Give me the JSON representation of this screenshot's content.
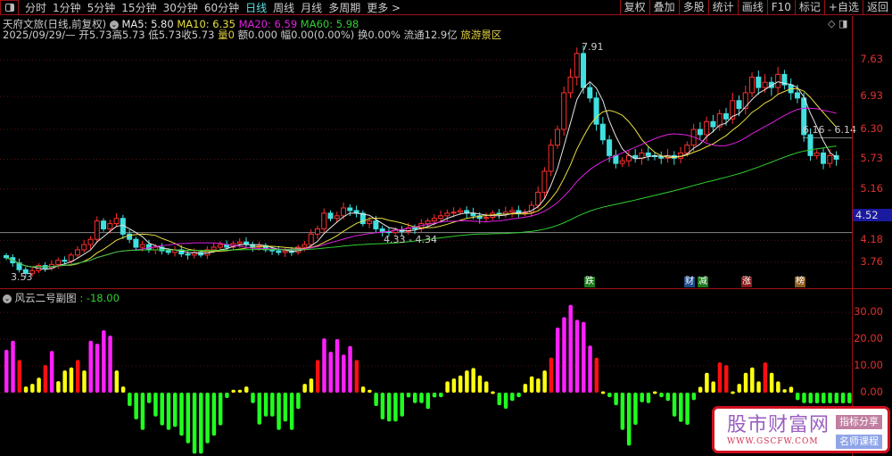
{
  "toolbar": {
    "periods": [
      "分时",
      "1分钟",
      "5分钟",
      "15分钟",
      "30分钟",
      "60分钟",
      "日线",
      "周线",
      "月线",
      "多周期",
      "更多 >"
    ],
    "active": "日线",
    "right_buttons": [
      "复权",
      "叠加",
      "多股",
      "统计",
      "画线",
      "F10",
      "标记",
      "+自选",
      "返回"
    ]
  },
  "info": {
    "title": "天府文旅(日线,前复权)",
    "ma5": "MA5: 5.80",
    "ma10": "MA10: 6.35",
    "ma20": "MA20: 6.59",
    "ma60": "MA60: 5.98",
    "date": "2025/09/29/—",
    "open": "开5.73",
    "high": "高5.73",
    "low": "低5.73",
    "close": "收5.73",
    "vol": "量0",
    "amount": "额0.000",
    "change": "幅0.00(0.00%)",
    "turnover": "换0.00%",
    "float": "流通12.9亿",
    "sector": "旅游景区"
  },
  "colors": {
    "ma5": "#e8e8e8",
    "ma10": "#e8e040",
    "ma20": "#e020e0",
    "ma60": "#30d030",
    "up": "#ff3030",
    "down": "#40e0e0"
  },
  "axis": {
    "price_ticks": [
      "7.63",
      "6.93",
      "6.30",
      "5.73",
      "5.16",
      "4.18",
      "3.76"
    ],
    "current_badge": "4.52",
    "sub_ticks": [
      "30.00",
      "20.00",
      "10.00",
      "0.00"
    ]
  },
  "annotations": {
    "max": "7.91",
    "min": "3.53",
    "range1": "4.33 - 4.34",
    "range2": "6.16 - 6.14"
  },
  "markers": [
    {
      "text": "跌",
      "bg": "#1a7a1a"
    },
    {
      "text": "财",
      "bg": "#1a4a8a"
    },
    {
      "text": "减",
      "bg": "#1a7a1a"
    },
    {
      "text": "涨",
      "bg": "#8a1a1a"
    },
    {
      "text": "榜",
      "bg": "#8a5a1a"
    }
  ],
  "sub": {
    "title": "风云二号副图",
    "value": ": -18.00"
  },
  "watermark": {
    "name": "股市财富网",
    "url": "WWW.GSCFW.COM",
    "tag1": "指标分享",
    "tag2": "名师课程"
  },
  "chart_data": {
    "type": "candlestick",
    "price_range": [
      3.45,
      7.95
    ],
    "closes": [
      3.85,
      3.75,
      3.62,
      3.55,
      3.6,
      3.7,
      3.65,
      3.72,
      3.8,
      3.78,
      3.9,
      4.0,
      4.1,
      4.2,
      4.55,
      4.4,
      4.5,
      4.6,
      4.3,
      4.2,
      4.05,
      4.1,
      4.0,
      4.05,
      3.98,
      3.95,
      4.0,
      3.92,
      3.9,
      3.95,
      3.9,
      4.0,
      4.05,
      4.1,
      4.05,
      4.12,
      4.15,
      4.1,
      4.05,
      4.08,
      4.0,
      3.98,
      3.95,
      3.98,
      3.95,
      4.05,
      4.1,
      4.3,
      4.4,
      4.7,
      4.6,
      4.65,
      4.8,
      4.75,
      4.7,
      4.5,
      4.55,
      4.4,
      4.35,
      4.33,
      4.38,
      4.35,
      4.42,
      4.4,
      4.5,
      4.55,
      4.6,
      4.65,
      4.7,
      4.72,
      4.75,
      4.7,
      4.65,
      4.6,
      4.62,
      4.7,
      4.68,
      4.72,
      4.75,
      4.7,
      4.72,
      4.85,
      5.1,
      5.5,
      6.0,
      6.3,
      7.0,
      7.3,
      7.75,
      7.1,
      6.9,
      6.4,
      6.1,
      5.8,
      5.65,
      5.7,
      5.8,
      5.75,
      5.85,
      5.8,
      5.78,
      5.75,
      5.8,
      5.75,
      5.85,
      6.0,
      6.3,
      6.2,
      6.45,
      6.35,
      6.6,
      6.5,
      6.85,
      6.7,
      7.0,
      7.3,
      7.1,
      7.2,
      7.1,
      7.35,
      7.15,
      7.0,
      6.9,
      6.2,
      5.8,
      5.85,
      5.65,
      5.8,
      5.73
    ],
    "indicator": {
      "name": "风云二号副图",
      "range": [
        -25,
        35
      ],
      "values": [
        16,
        19.4,
        12.2,
        2.3,
        3.3,
        5.6,
        10.3,
        15.6,
        4.3,
        8.3,
        9.4,
        12.2,
        8.3,
        19.4,
        18.3,
        23.3,
        21.3,
        8.3,
        2.3,
        -5,
        -10,
        -13.9,
        -3.9,
        -8.9,
        -12.2,
        -13.9,
        -12.8,
        -16.1,
        -18.9,
        -22.8,
        -22.8,
        -18.9,
        -16.1,
        -12.2,
        -2,
        1.1,
        1.1,
        2.3,
        -3.9,
        -11.9,
        -8.9,
        -8.9,
        -13.9,
        -10.8,
        -13.9,
        -6.1,
        3.3,
        5.3,
        12.2,
        20.3,
        15.3,
        20,
        14.2,
        17.4,
        12.2,
        2.3,
        1.1,
        -5,
        -10,
        -10.8,
        -10.8,
        -8.9,
        -1.8,
        -3.9,
        -3.9,
        -6.1,
        -1.8,
        -1.7,
        4.2,
        5.3,
        6.4,
        8.3,
        9.2,
        6.4,
        4.2,
        0.5,
        -4.7,
        -6,
        -3.1,
        -1.7,
        3.3,
        6.1,
        5.3,
        8.3,
        13.1,
        24.3,
        28.2,
        32.8,
        27.2,
        26.4,
        17.6,
        13.1,
        0.5,
        -1.7,
        -4.7,
        -13.9,
        -19.8,
        -12,
        -3.6,
        -3.9,
        0.5,
        -1.7,
        -3.1,
        -8.9,
        -10.9,
        -12,
        -2.8,
        2.2,
        7.4,
        4.2,
        11.3,
        10.3,
        0.5,
        3.3,
        7.4,
        9.4,
        4.2,
        11.3,
        7.4,
        4.2,
        1.3,
        2.2,
        -2.8,
        -3.9,
        -4,
        -4,
        -4,
        -4,
        -4,
        -4,
        -4
      ]
    }
  }
}
